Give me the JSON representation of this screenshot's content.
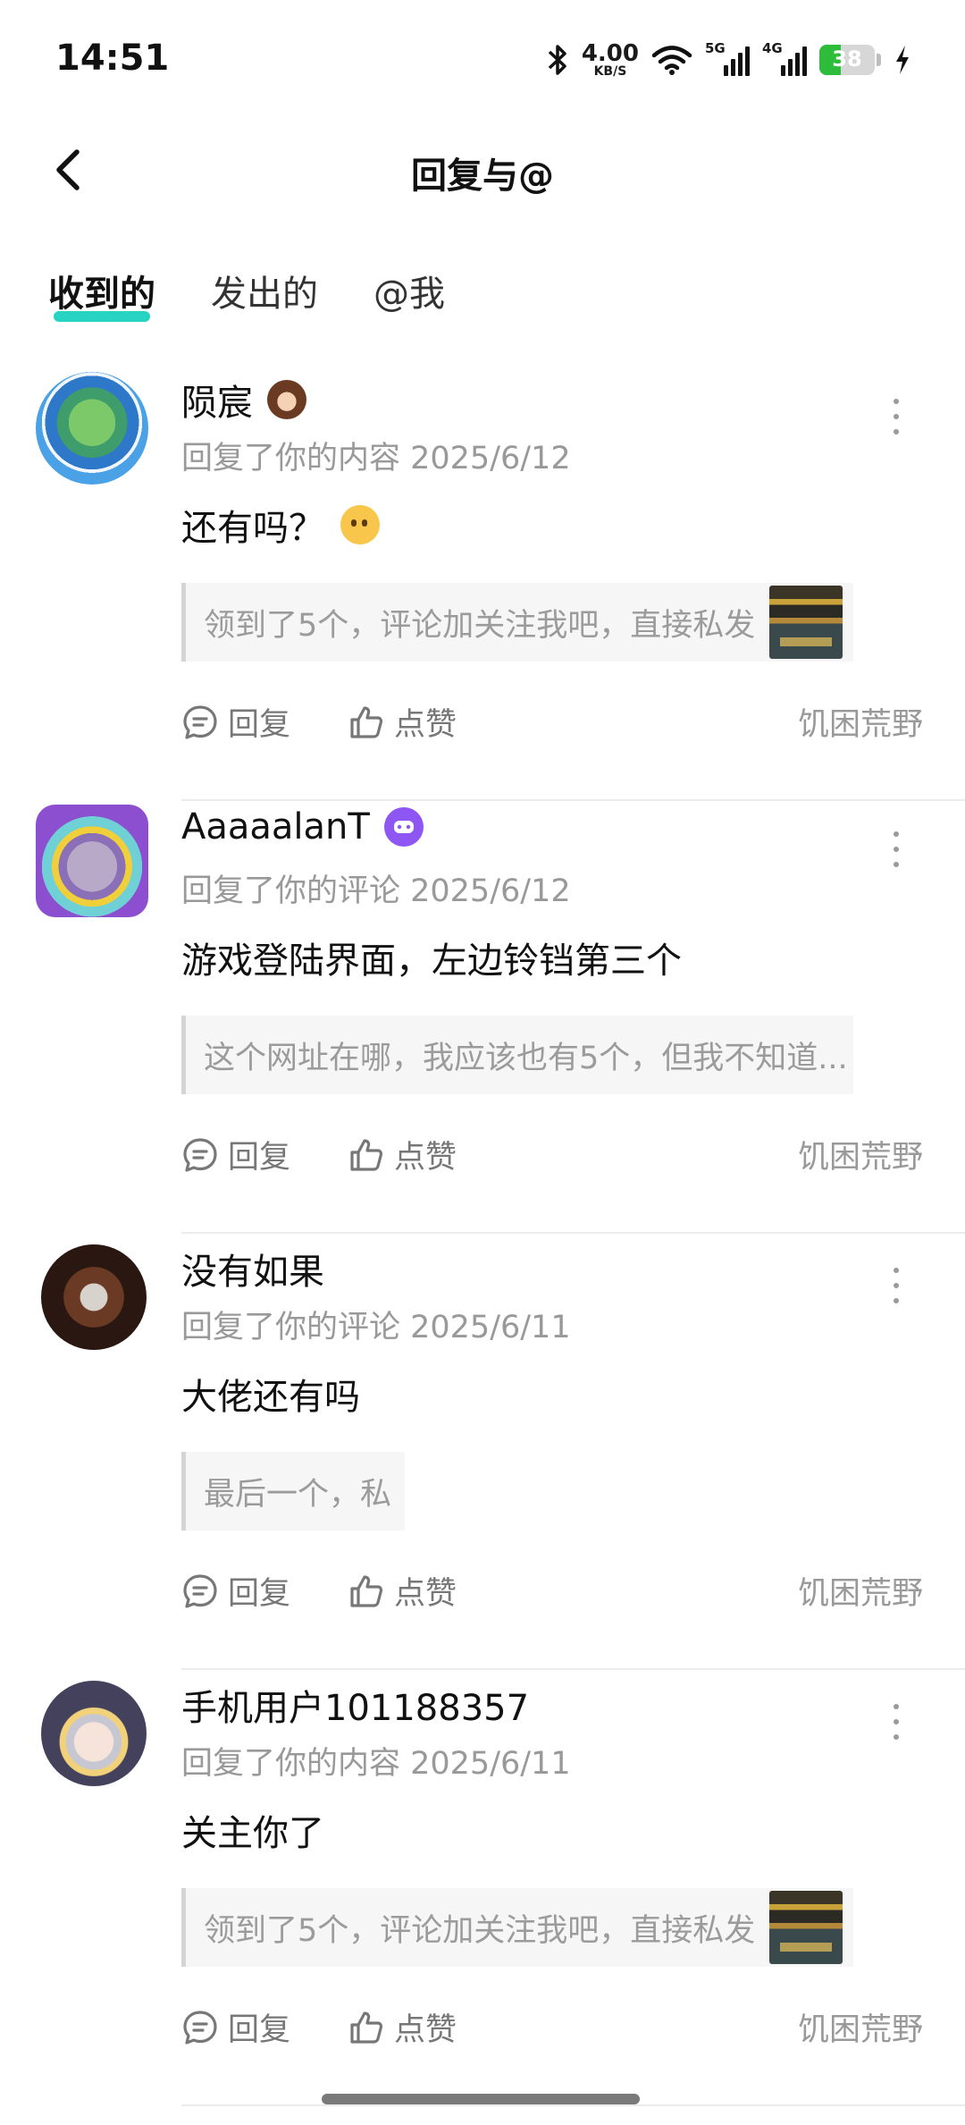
{
  "status_bar": {
    "time": "14:51",
    "net_speed_value": "4.00",
    "net_speed_unit": "KB/S",
    "signal_1_label": "5G",
    "signal_2_label": "4G",
    "battery": "38",
    "battery_level": 0.38
  },
  "header": {
    "title": "回复与@"
  },
  "tabs": [
    {
      "label": "收到的",
      "active": true
    },
    {
      "label": "发出的",
      "active": false
    },
    {
      "label": "@我",
      "active": false
    }
  ],
  "feed": [
    {
      "user": "陨宸",
      "meta": "回复了你的内容 2025/6/12",
      "content": "还有吗？",
      "has_emoji": true,
      "quote": "领到了5个，评论加关注我吧，直接私发",
      "has_thumb": true,
      "reply_label": "回复",
      "like_label": "点赞",
      "game": "饥困荒野"
    },
    {
      "user": "AaaaalanT",
      "meta": "回复了你的评论 2025/6/12",
      "content": "游戏登陆界面，左边铃铛第三个",
      "has_emoji": false,
      "quote": "这个网址在哪，我应该也有5个，但我不知道...",
      "has_thumb": false,
      "reply_label": "回复",
      "like_label": "点赞",
      "game": "饥困荒野"
    },
    {
      "user": "没有如果",
      "meta": "回复了你的评论 2025/6/11",
      "content": "大佬还有吗",
      "has_emoji": false,
      "quote": "最后一个，私",
      "has_thumb": false,
      "reply_label": "回复",
      "like_label": "点赞",
      "game": "饥困荒野"
    },
    {
      "user": "手机用户101188357",
      "meta": "回复了你的内容 2025/6/11",
      "content": "关主你了",
      "has_emoji": false,
      "quote": "领到了5个，评论加关注我吧，直接私发",
      "has_thumb": true,
      "reply_label": "回复",
      "like_label": "点赞",
      "game": "饥困荒野"
    }
  ],
  "colors": {
    "tab_underline": "#27d3c3",
    "battery_green": "#2ebd3a",
    "secondary_text": "#999999"
  }
}
